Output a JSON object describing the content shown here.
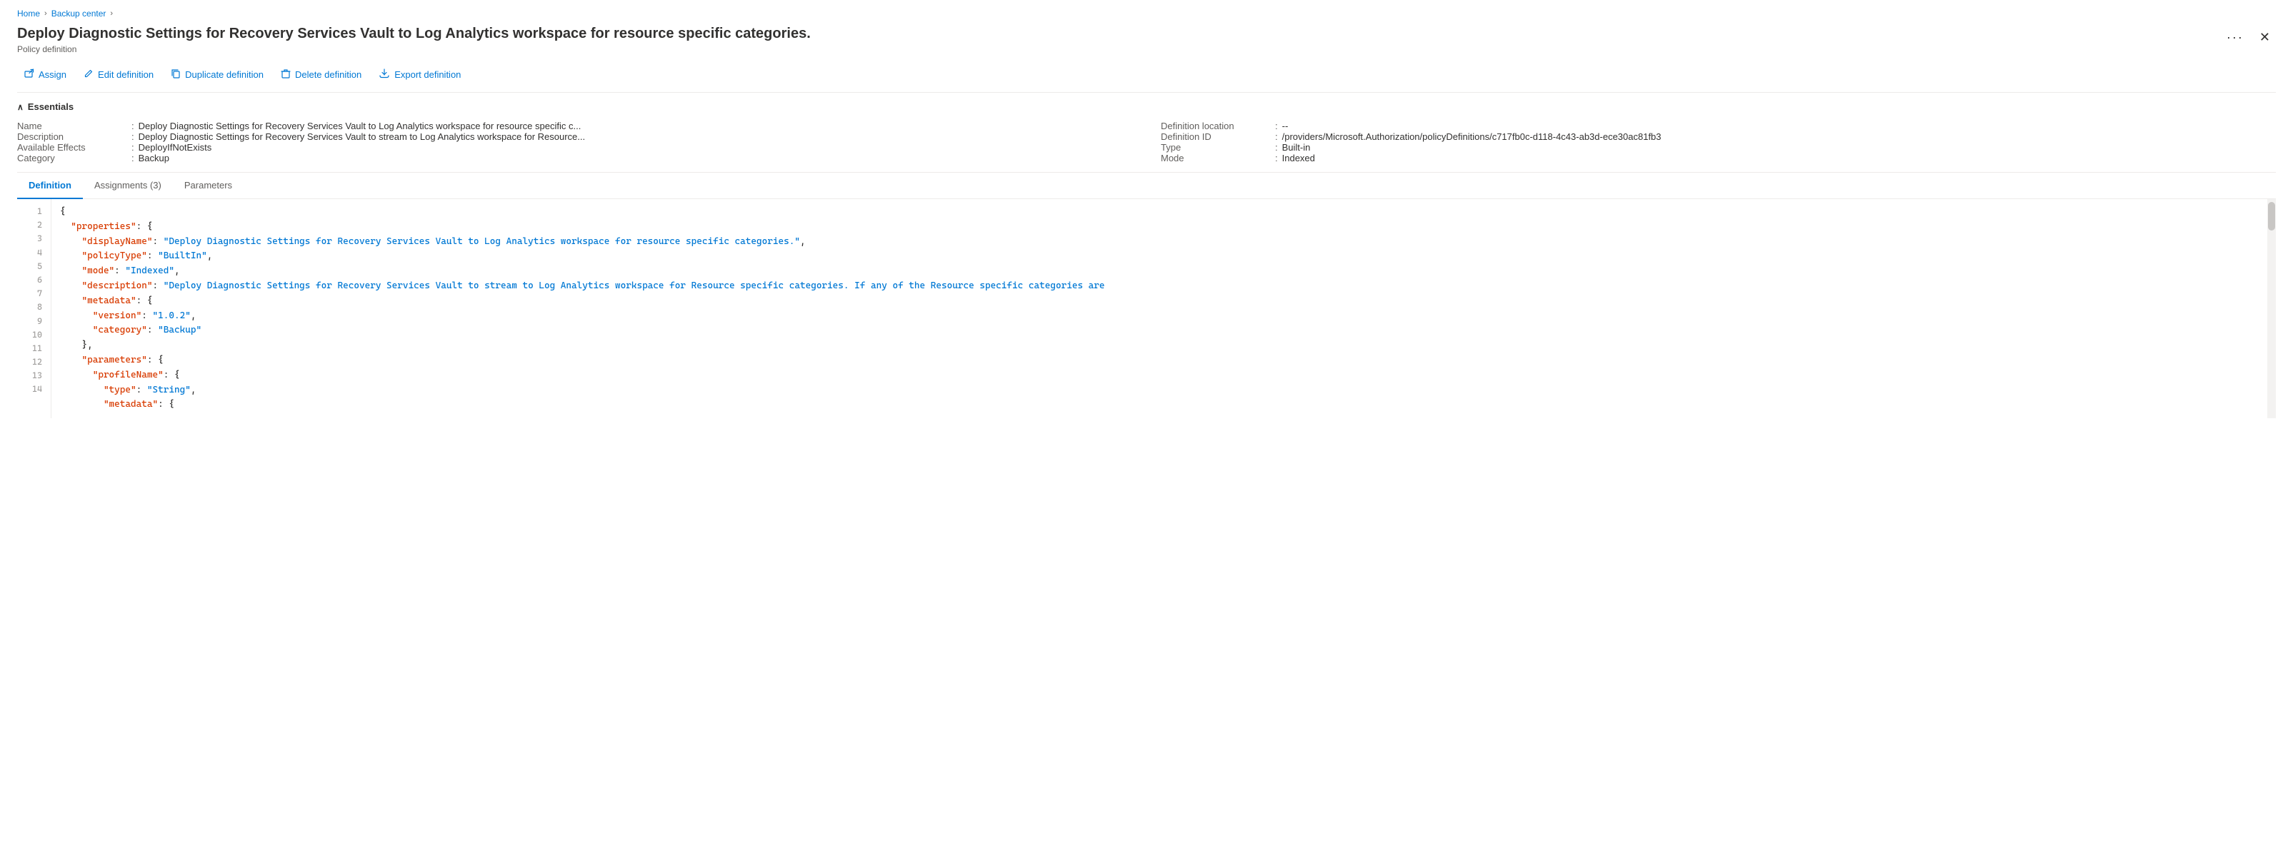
{
  "breadcrumb": {
    "items": [
      {
        "label": "Home",
        "active": true
      },
      {
        "label": "Backup center",
        "active": true
      },
      {
        "label": "",
        "active": false
      }
    ],
    "separators": [
      ">",
      ">"
    ]
  },
  "header": {
    "title": "Deploy Diagnostic Settings for Recovery Services Vault to Log Analytics workspace for resource specific categories.",
    "subtitle": "Policy definition",
    "more_label": "···",
    "close_label": "✕"
  },
  "toolbar": {
    "assign_label": "Assign",
    "edit_label": "Edit definition",
    "duplicate_label": "Duplicate definition",
    "delete_label": "Delete definition",
    "export_label": "Export definition"
  },
  "essentials": {
    "section_label": "Essentials",
    "rows_left": [
      {
        "label": "Name",
        "value": "Deploy Diagnostic Settings for Recovery Services Vault to Log Analytics workspace for resource specific c..."
      },
      {
        "label": "Description",
        "value": "Deploy Diagnostic Settings for Recovery Services Vault to stream to Log Analytics workspace for Resource..."
      },
      {
        "label": "Available Effects",
        "value": "DeployIfNotExists"
      },
      {
        "label": "Category",
        "value": "Backup"
      }
    ],
    "rows_right": [
      {
        "label": "Definition location",
        "value": "--"
      },
      {
        "label": "Definition ID",
        "value": "/providers/Microsoft.Authorization/policyDefinitions/c717fb0c-d118-4c43-ab3d-ece30ac81fb3"
      },
      {
        "label": "Type",
        "value": "Built-in"
      },
      {
        "label": "Mode",
        "value": "Indexed"
      }
    ]
  },
  "tabs": [
    {
      "label": "Definition",
      "active": true
    },
    {
      "label": "Assignments (3)",
      "active": false
    },
    {
      "label": "Parameters",
      "active": false
    }
  ],
  "code": {
    "lines": [
      {
        "num": 1,
        "content": "{"
      },
      {
        "num": 2,
        "content": "  \"properties\": {"
      },
      {
        "num": 3,
        "content": "    \"displayName\": \"Deploy Diagnostic Settings for Recovery Services Vault to Log Analytics workspace for resource specific categories.\","
      },
      {
        "num": 4,
        "content": "    \"policyType\": \"BuiltIn\","
      },
      {
        "num": 5,
        "content": "    \"mode\": \"Indexed\","
      },
      {
        "num": 6,
        "content": "    \"description\": \"Deploy Diagnostic Settings for Recovery Services Vault to stream to Log Analytics workspace for Resource specific categories. If any of the Resource specific categories are"
      },
      {
        "num": 7,
        "content": "    \"metadata\": {"
      },
      {
        "num": 8,
        "content": "      \"version\": \"1.0.2\","
      },
      {
        "num": 9,
        "content": "      \"category\": \"Backup\""
      },
      {
        "num": 10,
        "content": "    },"
      },
      {
        "num": 11,
        "content": "    \"parameters\": {"
      },
      {
        "num": 12,
        "content": "      \"profileName\": {"
      },
      {
        "num": 13,
        "content": "        \"type\": \"String\","
      },
      {
        "num": 14,
        "content": "        \"metadata\": {"
      }
    ]
  }
}
